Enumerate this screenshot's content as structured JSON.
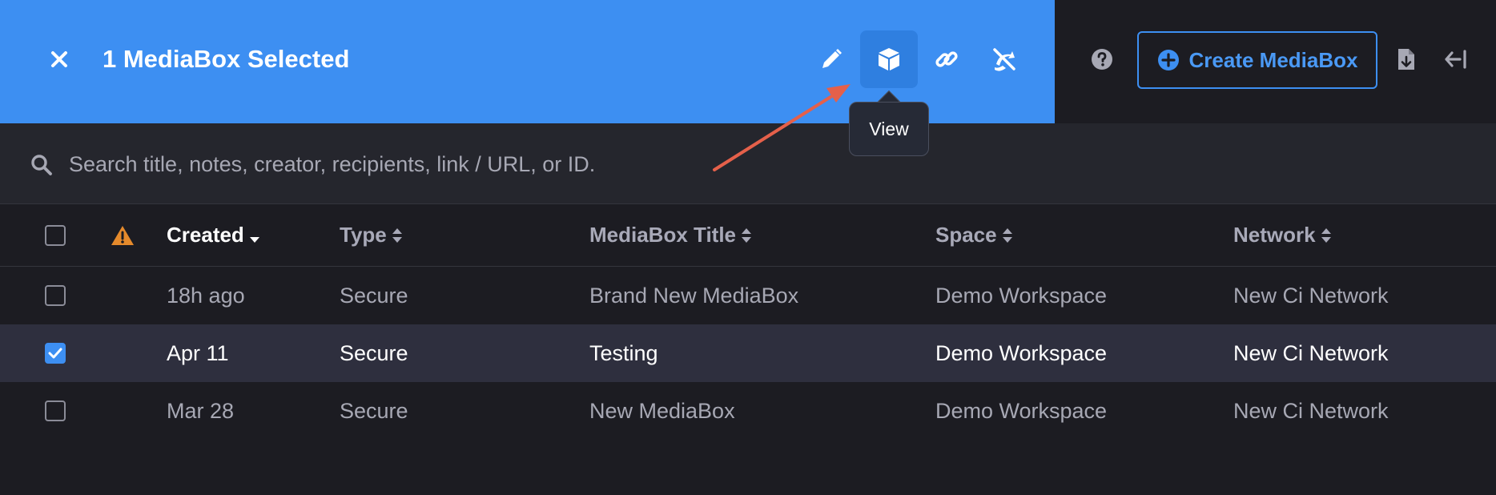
{
  "header": {
    "selection_title": "1 MediaBox Selected",
    "tooltip_text": "View",
    "create_button_label": "Create MediaBox",
    "accent_color": "#3d8ff2"
  },
  "toolbar_icons": [
    "edit-pencil-icon",
    "view-cube-icon",
    "link-icon",
    "disable-link-icon"
  ],
  "search": {
    "placeholder": "Search title, notes, creator, recipients, link / URL, or ID."
  },
  "table": {
    "columns": [
      "Created",
      "Type",
      "MediaBox Title",
      "Space",
      "Network"
    ],
    "sorted_column": "Created",
    "rows": [
      {
        "created": "18h ago",
        "type": "Secure",
        "title": "Brand New MediaBox",
        "space": "Demo Workspace",
        "network": "New Ci Network",
        "checked": false
      },
      {
        "created": "Apr 11",
        "type": "Secure",
        "title": "Testing",
        "space": "Demo Workspace",
        "network": "New Ci Network",
        "checked": true
      },
      {
        "created": "Mar 28",
        "type": "Secure",
        "title": "New MediaBox",
        "space": "Demo Workspace",
        "network": "New Ci Network",
        "checked": false
      }
    ]
  }
}
